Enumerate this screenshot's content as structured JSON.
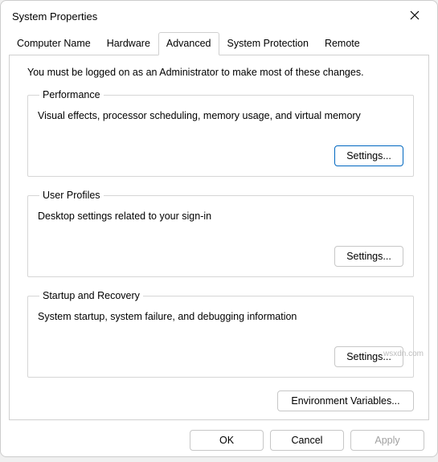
{
  "window": {
    "title": "System Properties"
  },
  "tabs": {
    "computer_name": "Computer Name",
    "hardware": "Hardware",
    "advanced": "Advanced",
    "system_protection": "System Protection",
    "remote": "Remote"
  },
  "advanced_panel": {
    "intro": "You must be logged on as an Administrator to make most of these changes.",
    "performance": {
      "legend": "Performance",
      "desc": "Visual effects, processor scheduling, memory usage, and virtual memory",
      "button": "Settings..."
    },
    "user_profiles": {
      "legend": "User Profiles",
      "desc": "Desktop settings related to your sign-in",
      "button": "Settings..."
    },
    "startup_recovery": {
      "legend": "Startup and Recovery",
      "desc": "System startup, system failure, and debugging information",
      "button": "Settings..."
    },
    "env_vars_button": "Environment Variables..."
  },
  "footer": {
    "ok": "OK",
    "cancel": "Cancel",
    "apply": "Apply"
  },
  "watermark": "wsxdn.com"
}
